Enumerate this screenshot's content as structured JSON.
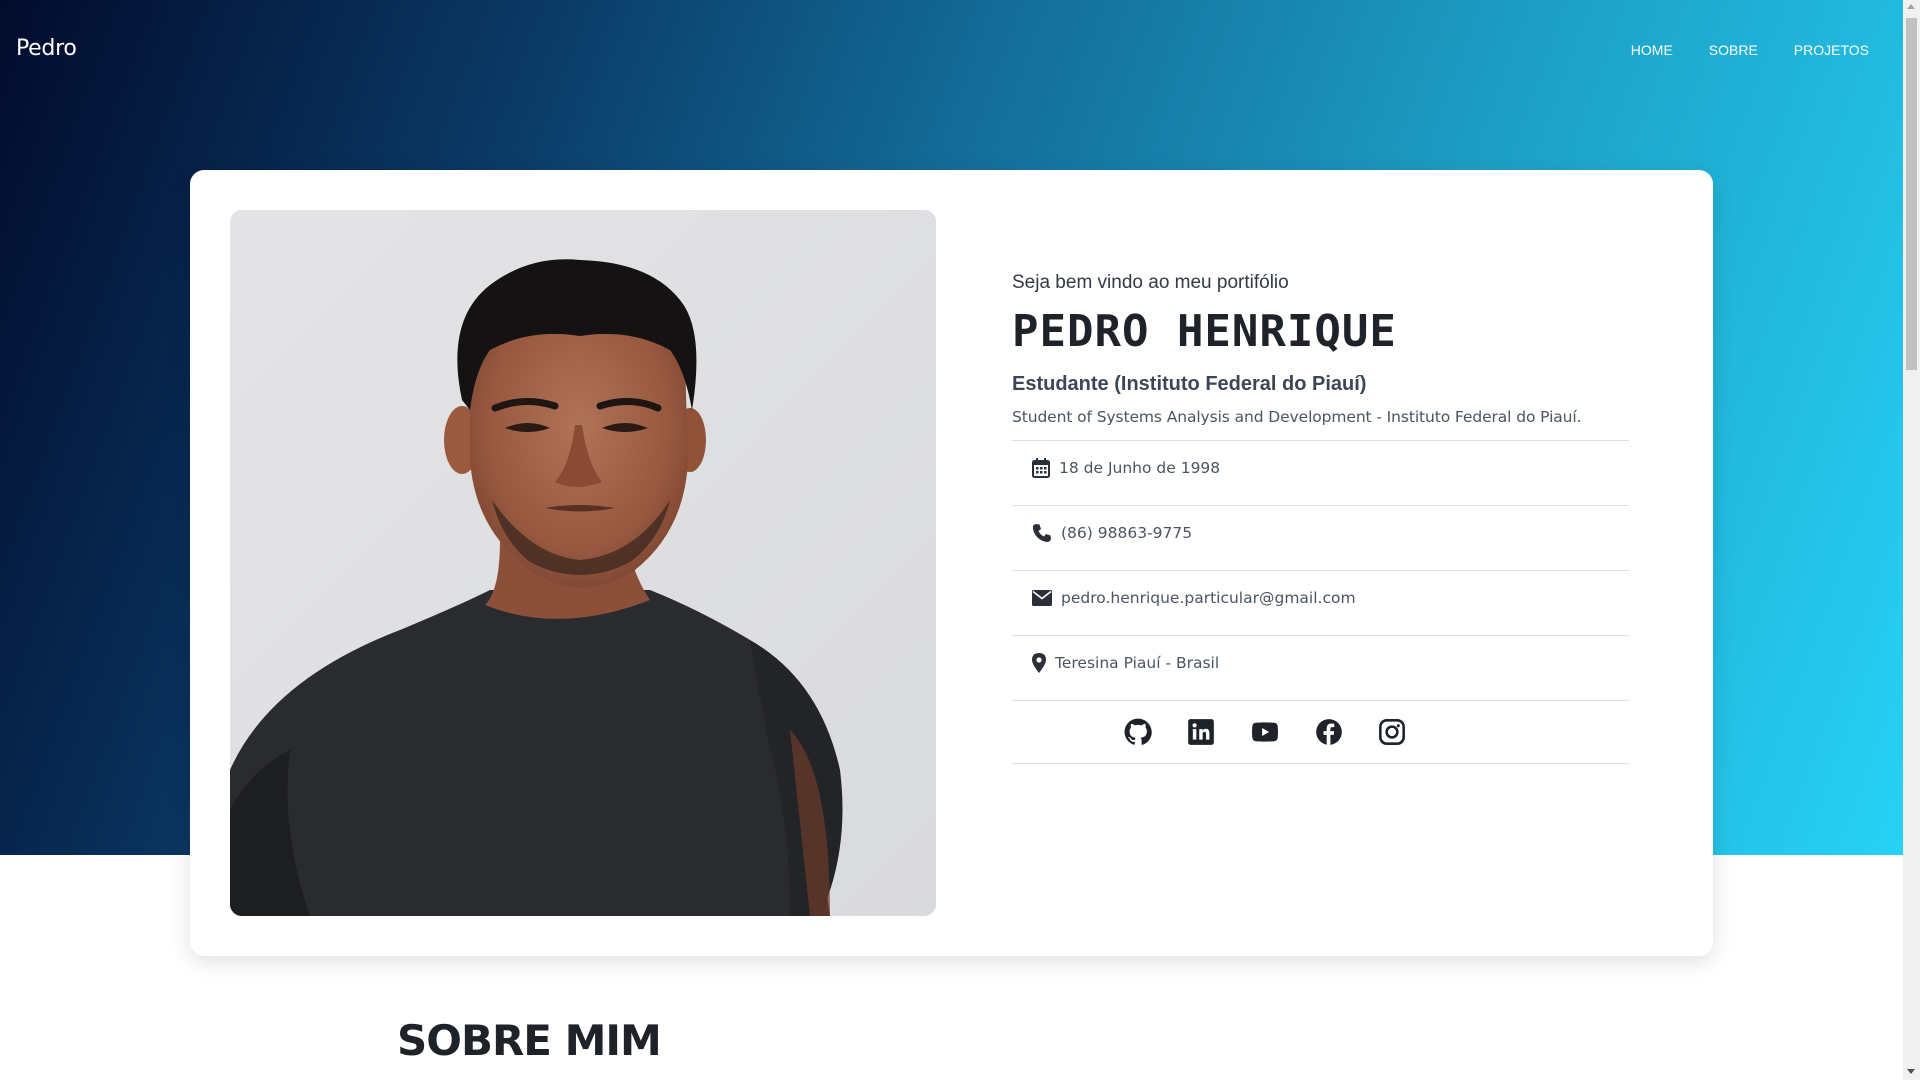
{
  "nav": {
    "brand": "Pedro",
    "links": [
      "HOME",
      "SOBRE",
      "PROJETOS"
    ]
  },
  "profile": {
    "greeting": "Seja bem vindo ao meu portifólio",
    "name": "PEDRO HENRIQUE",
    "role": "Estudante (Instituto Federal do Piauí)",
    "description": "Student of Systems Analysis and Development - Instituto Federal do Piauí.",
    "details": [
      {
        "icon": "calendar-icon",
        "text": "18 de Junho de 1998"
      },
      {
        "icon": "phone-icon",
        "text": "(86) 98863-9775"
      },
      {
        "icon": "envelope-icon",
        "text": "pedro.henrique.particular@gmail.com"
      },
      {
        "icon": "map-marker-icon",
        "text": "Teresina Piauí - Brasil"
      }
    ],
    "social": [
      "github-icon",
      "linkedin-icon",
      "youtube-icon",
      "facebook-icon",
      "instagram-icon"
    ]
  },
  "about": {
    "title": "SOBRE MIM"
  },
  "colors": {
    "gradient_start": "#020b2c",
    "gradient_end": "#27d2f5",
    "text_dark": "#1e2329",
    "icon_color": "#2b3038"
  }
}
